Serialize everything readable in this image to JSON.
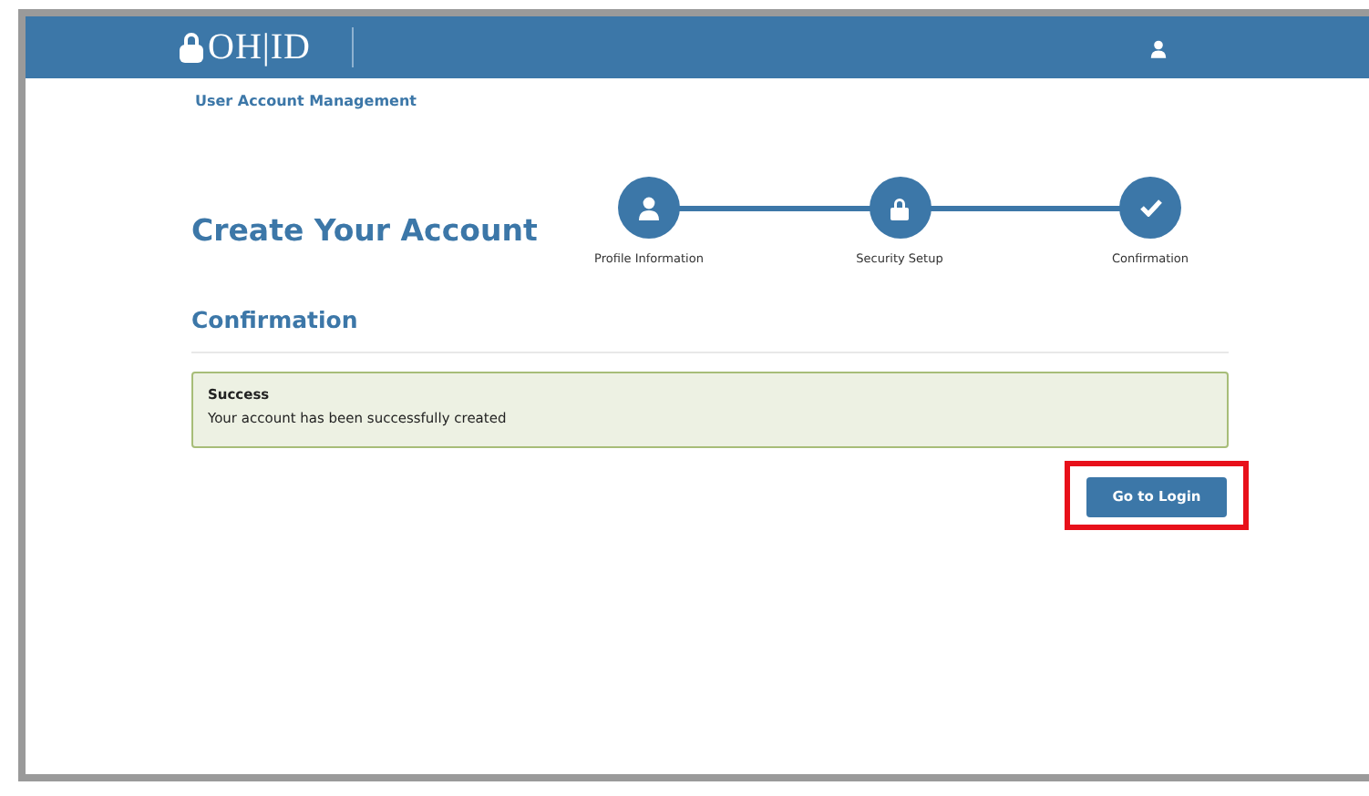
{
  "header": {
    "logo": "OH|ID"
  },
  "app_name": "User Account Management",
  "page_title": "Create Your Account",
  "steps": [
    {
      "kind": "person",
      "label": "Profile Information"
    },
    {
      "kind": "lock",
      "label": "Security Setup"
    },
    {
      "kind": "check",
      "label": "Confirmation"
    }
  ],
  "section_title": "Confirmation",
  "alert": {
    "title": "Success",
    "message": "Your account has been successfully created"
  },
  "button": {
    "label": "Go to Login",
    "highlighted": true
  }
}
